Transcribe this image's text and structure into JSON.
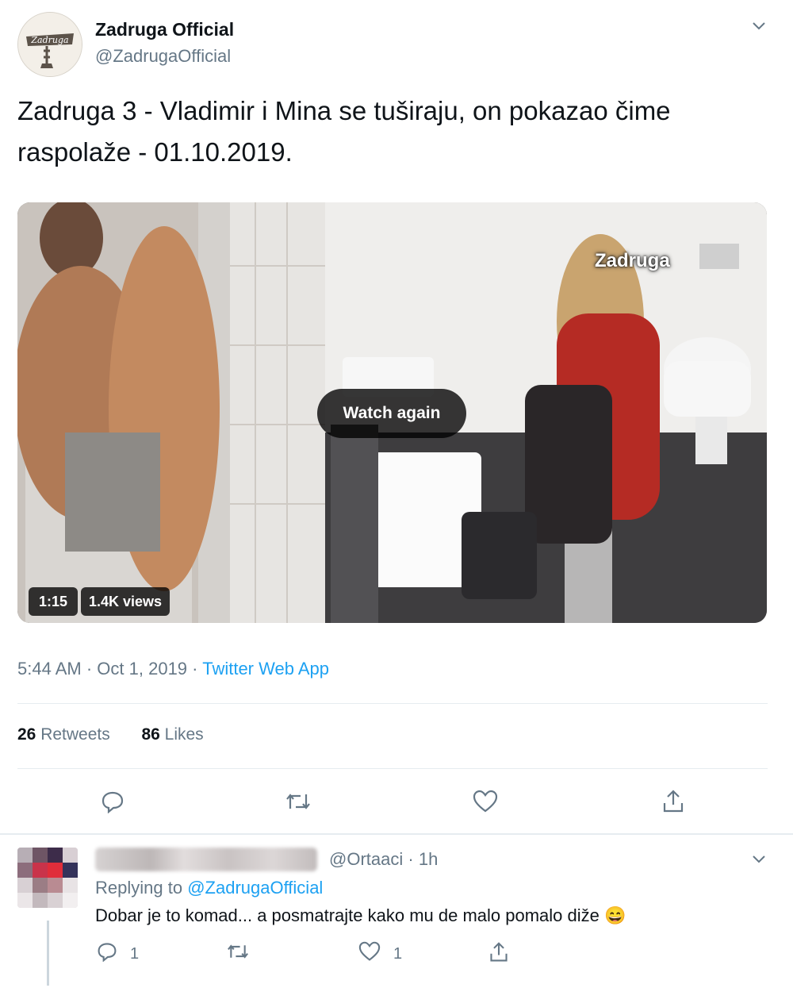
{
  "tweet": {
    "author_name": "Zadruga Official",
    "author_handle": "@ZadrugaOfficial",
    "avatar_logo_text": "Zadruga",
    "text": "Zadruga 3 - Vladimir i Mina se tuširaju, on pokazao čime raspolaže - 01.10.2019.",
    "media": {
      "watermark": "Zadruga",
      "button_label": "Watch again",
      "duration": "1:15",
      "views": "1.4K views"
    },
    "time": "5:44 AM",
    "date": "Oct 1, 2019",
    "source": "Twitter Web App",
    "stats": {
      "retweets_count": "26",
      "retweets_label": "Retweets",
      "likes_count": "86",
      "likes_label": "Likes"
    },
    "icons": [
      "reply-icon",
      "retweet-icon",
      "like-icon",
      "share-icon",
      "chevron-down-icon"
    ]
  },
  "reply": {
    "handle": "@Ortaaci",
    "time": "1h",
    "replying_prefix": "Replying to",
    "replying_to": "@ZadrugaOfficial",
    "text": "Dobar je to komad... a posmatrajte kako mu de malo pomalo diže",
    "emoji": "😄",
    "reply_count": "1",
    "like_count": "1"
  },
  "colors": {
    "link": "#1da1f2",
    "muted": "#657786",
    "text": "#0f1419"
  }
}
